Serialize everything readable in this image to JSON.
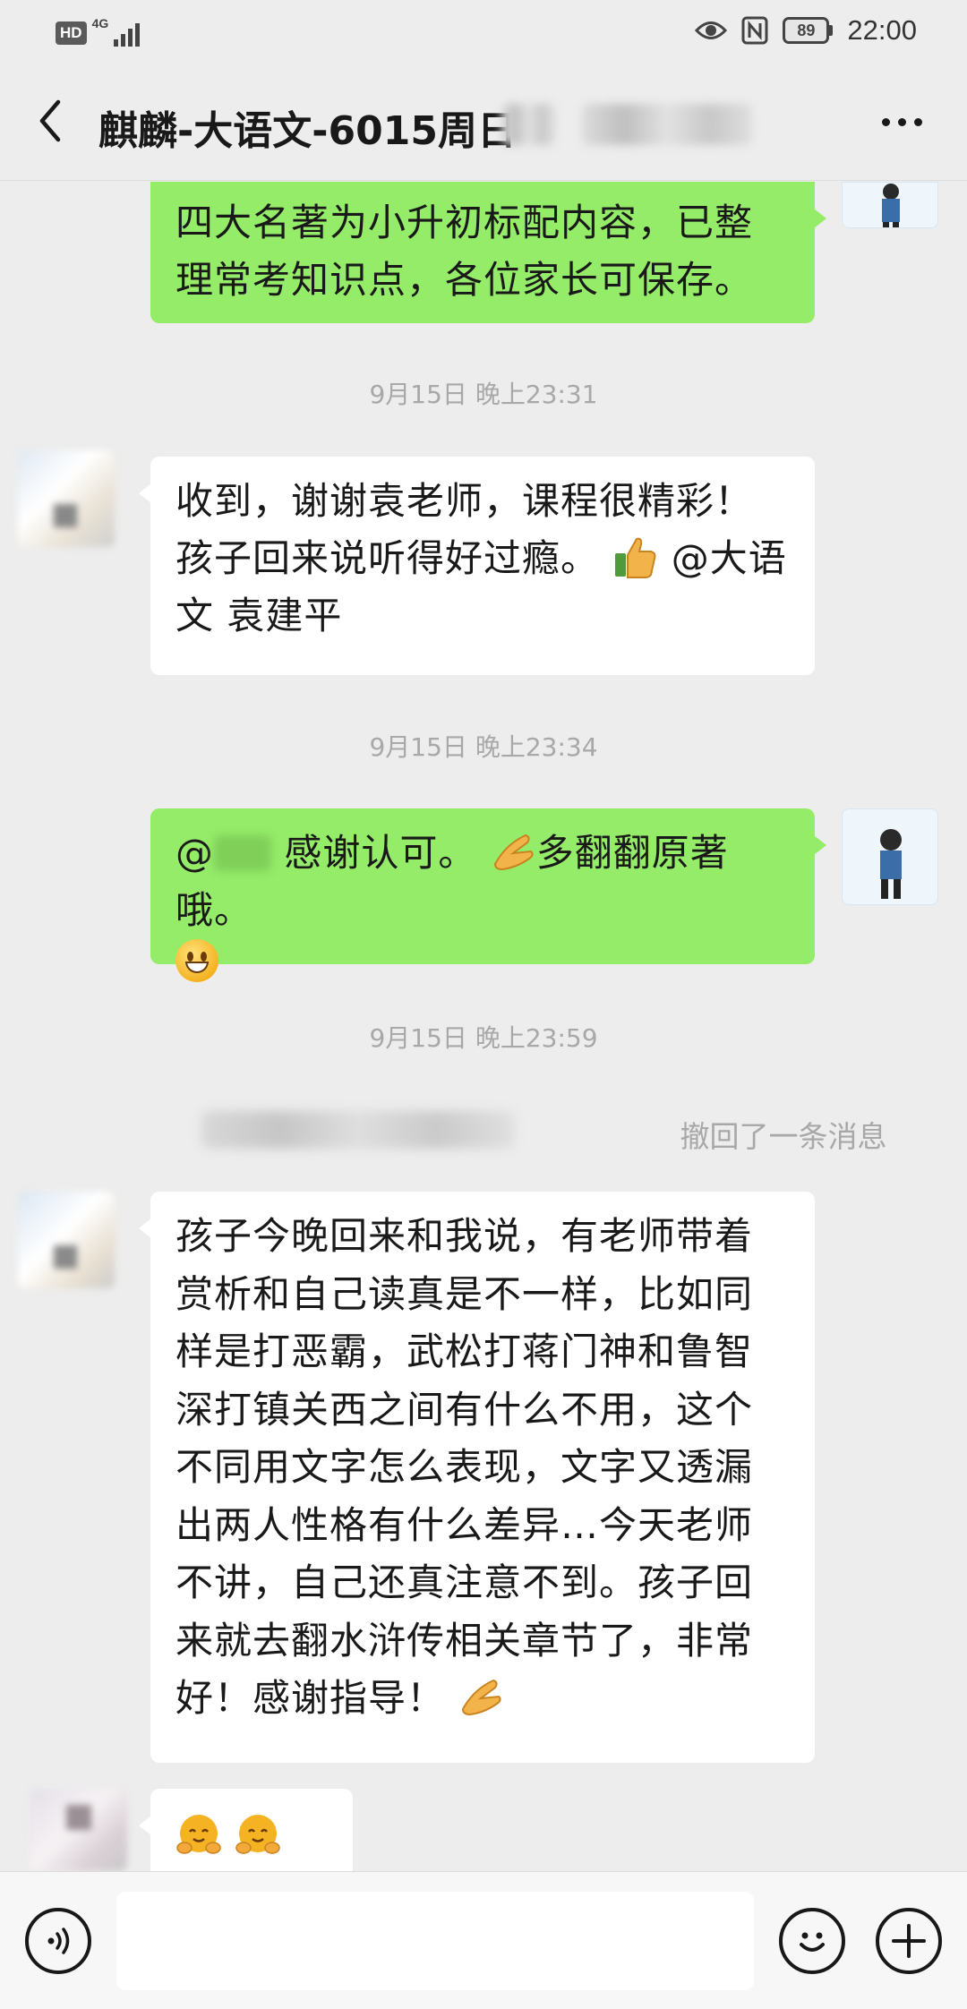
{
  "status_bar": {
    "hd_label": "HD",
    "network_label": "4G",
    "battery_level": "89",
    "time": "22:00"
  },
  "nav": {
    "title": "麒麟-大语文-6015周日"
  },
  "messages": [
    {
      "id": "m1",
      "sender": "me",
      "lines": [
        "四大名著为小升初标配内容，已整",
        "理常考知识点，各位家长可保存。"
      ]
    },
    {
      "id": "t1",
      "type": "timestamp",
      "text": "9月15日 晚上23:31"
    },
    {
      "id": "m2",
      "sender": "other",
      "lines": [
        "收到，谢谢袁老师，课程很精彩！",
        "孩子回来说听得好过瘾。",
        "@大语",
        "文 袁建平"
      ]
    },
    {
      "id": "t2",
      "type": "timestamp",
      "text": "9月15日 晚上23:34"
    },
    {
      "id": "m3",
      "sender": "me",
      "prefix": "@",
      "text": "感谢认可。",
      "text2": "多翻翻原著哦。"
    },
    {
      "id": "t3",
      "type": "timestamp",
      "text": "9月15日 晚上23:59"
    },
    {
      "id": "r1",
      "type": "recall",
      "text": "撤回了一条消息"
    },
    {
      "id": "m4",
      "sender": "other",
      "lines": [
        "孩子今晚回来和我说，有老师带着",
        "赏析和自己读真是不一样，比如同",
        "样是打恶霸，武松打蒋门神和鲁智",
        "深打镇关西之间有什么不用，这个",
        "不同用文字怎么表现，文字又透漏",
        "出两人性格有什么差异…今天老师",
        "不讲，自己还真注意不到。孩子回",
        "来就去翻水浒传相关章节了，非常",
        "好！感谢指导！"
      ]
    },
    {
      "id": "m5",
      "sender": "other",
      "emoji_names": [
        "hugging-face-emoji",
        "hugging-face-emoji",
        "hugging-face-emoji"
      ]
    }
  ],
  "icons": {
    "back": "chevron-left-icon",
    "more": "more-dots-icon",
    "voice": "voice-icon",
    "emoji": "smiley-icon",
    "plus": "plus-icon"
  },
  "colors": {
    "my_bubble": "#95ec69",
    "other_bubble": "#ffffff",
    "background": "#ededed",
    "timestamp": "#a8a8a8"
  }
}
